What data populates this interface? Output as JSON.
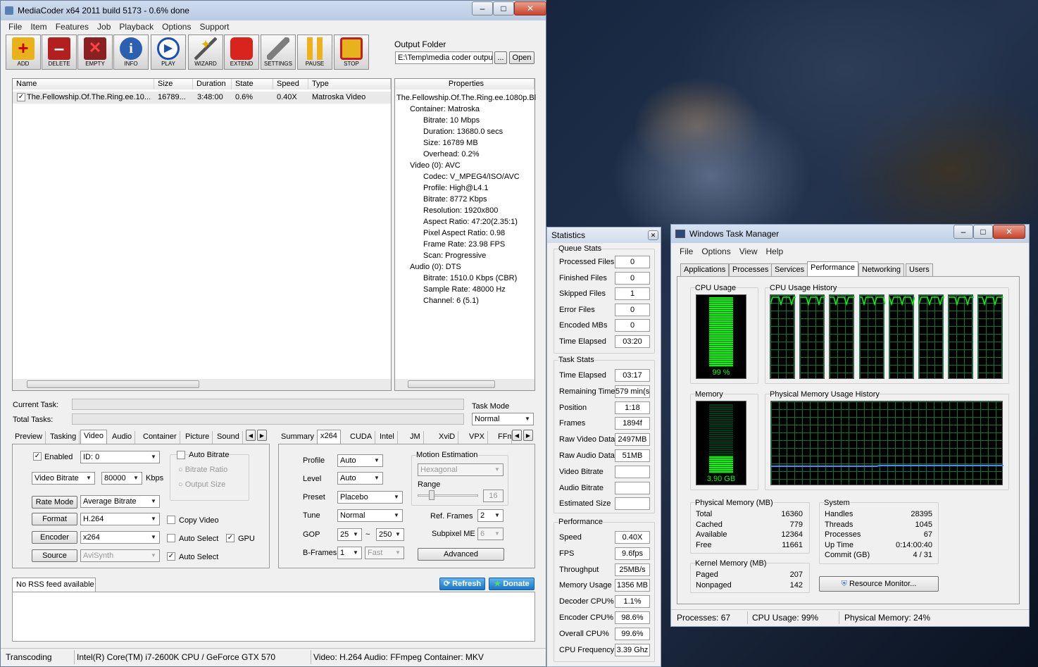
{
  "mc": {
    "title": "MediaCoder x64 2011 build 5173 -  0.6% done",
    "menu": [
      "File",
      "Item",
      "Features",
      "Job",
      "Playback",
      "Options",
      "Support"
    ],
    "toolbar": [
      "ADD",
      "DELETE",
      "EMPTY",
      "INFO",
      "PLAY",
      "WIZARD",
      "EXTEND",
      "SETTINGS",
      "PAUSE",
      "STOP"
    ],
    "output_folder_label": "Output Folder",
    "output_folder": "E:\\Temp\\media coder outpu",
    "browse": "...",
    "open": "Open",
    "cols": [
      "Name",
      "Size",
      "Duration",
      "State",
      "Speed",
      "Type"
    ],
    "file": {
      "name": "The.Fellowship.Of.The.Ring.ee.10...",
      "size": "16789...",
      "duration": "3:48:00",
      "state": "0.6%",
      "speed": "0.40X",
      "type": "Matroska Video"
    },
    "props_header": "Properties",
    "props": [
      "The.Fellowship.Of.The.Ring.ee.1080p.Bl",
      "Container: Matroska",
      "Bitrate: 10 Mbps",
      "Duration: 13680.0 secs",
      "Size: 16789 MB",
      "Overhead: 0.2%",
      "Video (0): AVC",
      "Codec: V_MPEG4/ISO/AVC",
      "Profile: High@L4.1",
      "Bitrate: 8772 Kbps",
      "Resolution: 1920x800",
      "Aspect Ratio: 47:20(2.35:1)",
      "Pixel Aspect Ratio: 0.98",
      "Frame Rate: 23.98 FPS",
      "Scan: Progressive",
      "Audio (0): DTS",
      "Bitrate: 1510.0 Kbps (CBR)",
      "Sample Rate: 48000 Hz",
      "Channel: 6 (5.1)"
    ],
    "current_task": "Current Task:",
    "total_tasks": "Total Tasks:",
    "task_mode_label": "Task Mode",
    "task_mode": "Normal",
    "tabs_left": [
      "Preview",
      "Tasking",
      "Video",
      "Audio",
      "Container",
      "Picture",
      "Sound"
    ],
    "tabs_right": [
      "Summary",
      "x264",
      "CUDA",
      "Intel",
      "JM",
      "XviD",
      "VPX",
      "FFm"
    ],
    "video": {
      "enabled": "Enabled",
      "id": "ID: 0",
      "mode": "Video Bitrate",
      "bitrate": "80000",
      "unit": "Kbps",
      "auto_bitrate": "Auto Bitrate",
      "bitrate_ratio": "Bitrate Ratio",
      "output_size": "Output Size",
      "rate_mode_btn": "Rate Mode",
      "rate_mode": "Average Bitrate",
      "format_btn": "Format",
      "format": "H.264",
      "encoder_btn": "Encoder",
      "encoder": "x264",
      "source_btn": "Source",
      "source": "AviSynth",
      "copy_video": "Copy Video",
      "auto_select": "Auto Select",
      "gpu": "GPU",
      "auto_select2": "Auto Select"
    },
    "x264": {
      "profile_l": "Profile",
      "profile": "Auto",
      "level_l": "Level",
      "level": "Auto",
      "preset_l": "Preset",
      "preset": "Placebo",
      "tune_l": "Tune",
      "tune": "Normal",
      "gop_l": "GOP",
      "gop1": "25",
      "tilde": "~",
      "gop2": "250",
      "bframes_l": "B-Frames",
      "bframes": "1",
      "bmode": "Fast",
      "me_label": "Motion Estimation",
      "me": "Hexagonal",
      "range_l": "Range",
      "range": "16",
      "ref_l": "Ref. Frames",
      "ref": "2",
      "subme_l": "Subpixel ME",
      "subme": "6",
      "advanced": "Advanced"
    },
    "rss": "No RSS feed available",
    "refresh": "Refresh",
    "donate": "Donate",
    "status": [
      "Transcoding",
      "Intel(R) Core(TM) i7-2600K CPU  / GeForce GTX 570",
      "Video: H.264  Audio: FFmpeg  Container: MKV"
    ]
  },
  "stats": {
    "title": "Statistics",
    "queue": "Queue Stats",
    "queue_rows": [
      [
        "Processed Files",
        "0"
      ],
      [
        "Finished Files",
        "0"
      ],
      [
        "Skipped Files",
        "1"
      ],
      [
        "Error Files",
        "0"
      ],
      [
        "Encoded MBs",
        "0"
      ],
      [
        "Time Elapsed",
        "03:20"
      ]
    ],
    "task": "Task Stats",
    "task_rows": [
      [
        "Time Elapsed",
        "03:17"
      ],
      [
        "Remaining Time",
        "579 min(s"
      ],
      [
        "Position",
        "1:18"
      ],
      [
        "Frames",
        "1894f"
      ],
      [
        "Raw Video Data",
        "2497MB"
      ],
      [
        "Raw Audio Data",
        "51MB"
      ],
      [
        "Video Bitrate",
        ""
      ],
      [
        "Audio Bitrate",
        ""
      ],
      [
        "Estimated Size",
        ""
      ]
    ],
    "perf": "Performance",
    "perf_rows": [
      [
        "Speed",
        "0.40X"
      ],
      [
        "FPS",
        "9.6fps"
      ],
      [
        "Throughput",
        "25MB/s"
      ],
      [
        "Memory Usage",
        "1356 MB"
      ],
      [
        "Decoder CPU%",
        "1.1%"
      ],
      [
        "Encoder CPU%",
        "98.6%"
      ],
      [
        "Overall CPU%",
        "99.6%"
      ],
      [
        "CPU Frequency",
        "3.39 Ghz"
      ]
    ]
  },
  "tm": {
    "title": "Windows Task Manager",
    "menu": [
      "File",
      "Options",
      "View",
      "Help"
    ],
    "tabs": [
      "Applications",
      "Processes",
      "Services",
      "Performance",
      "Networking",
      "Users"
    ],
    "cpu_usage": "CPU Usage",
    "cpu_value": "99 %",
    "cpu_hist": "CPU Usage History",
    "memory": "Memory",
    "mem_value": "3.90 GB",
    "mem_hist": "Physical Memory Usage History",
    "cpu_level": 0.99,
    "mem_level": 0.24,
    "phys_title": "Physical Memory (MB)",
    "phys": [
      [
        "Total",
        "16360"
      ],
      [
        "Cached",
        "779"
      ],
      [
        "Available",
        "12364"
      ],
      [
        "Free",
        "11661"
      ]
    ],
    "kernel_title": "Kernel Memory (MB)",
    "kernel": [
      [
        "Paged",
        "207"
      ],
      [
        "Nonpaged",
        "142"
      ]
    ],
    "sys_title": "System",
    "sys": [
      [
        "Handles",
        "28395"
      ],
      [
        "Threads",
        "1045"
      ],
      [
        "Processes",
        "67"
      ],
      [
        "Up Time",
        "0:14:00:40"
      ],
      [
        "Commit (GB)",
        "4 / 31"
      ]
    ],
    "resmon": "Resource Monitor...",
    "status": [
      "Processes: 67",
      "CPU Usage: 99%",
      "Physical Memory: 24%"
    ]
  }
}
